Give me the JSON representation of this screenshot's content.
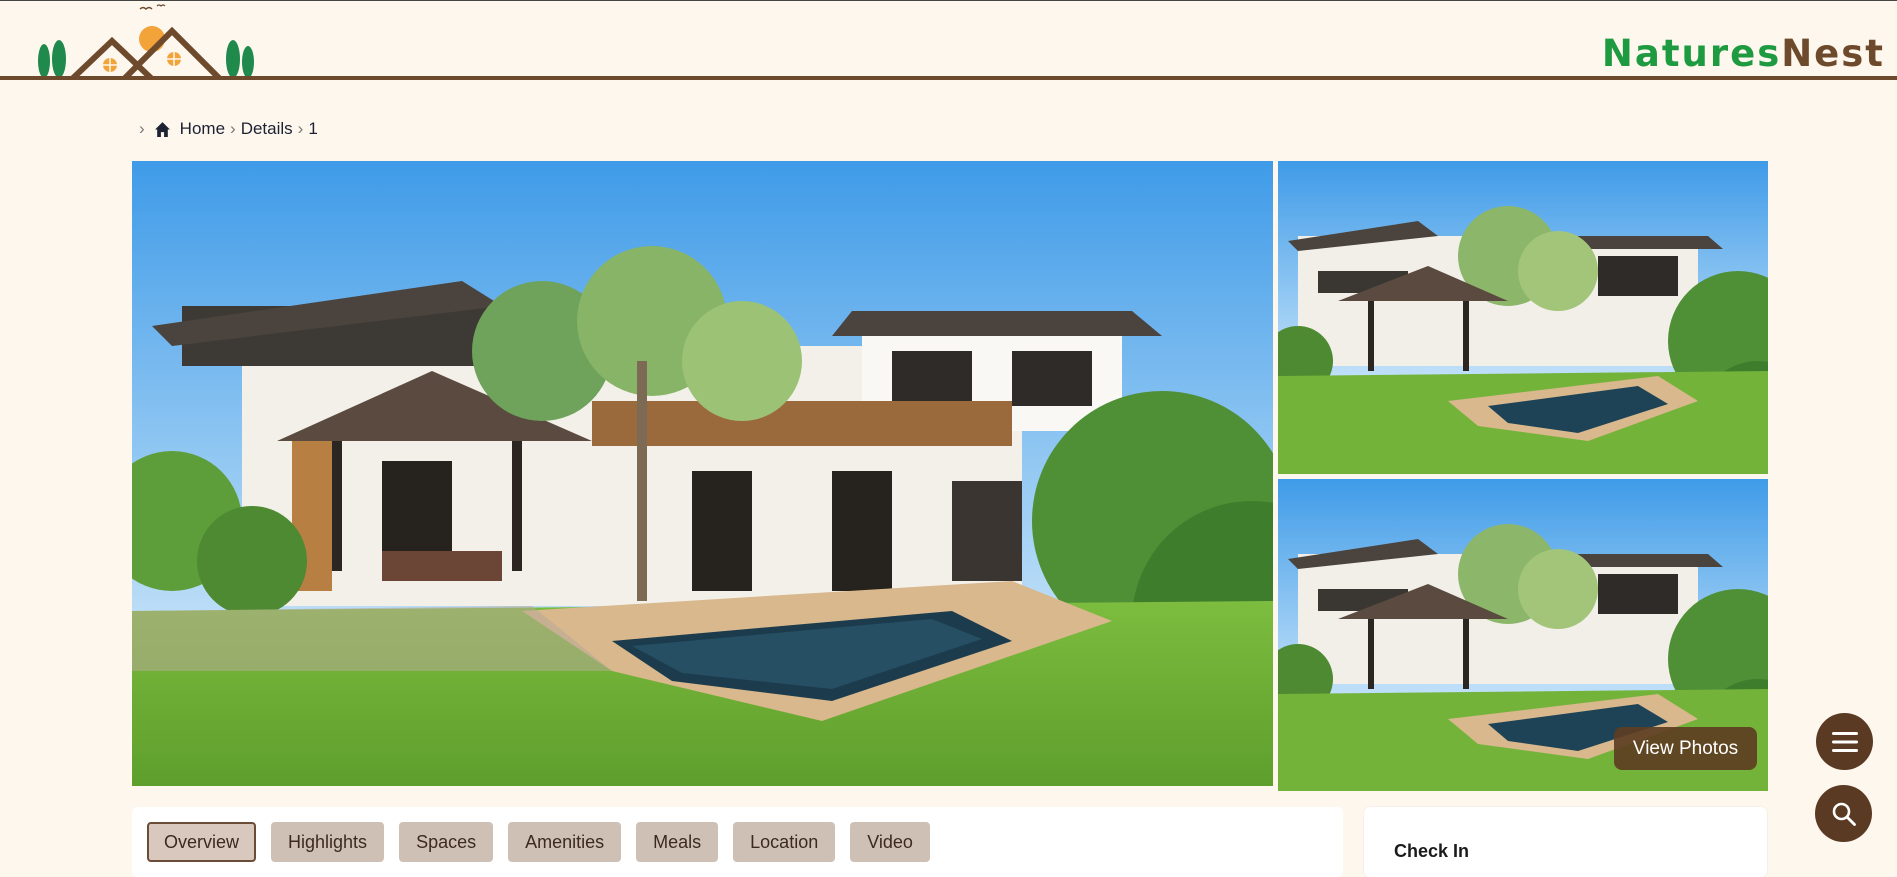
{
  "header": {
    "brand_part1": "Natures",
    "brand_part2": "Nest",
    "logo_icon": "house-logo",
    "colors": {
      "brand_green": "#1e9a41",
      "brand_brown": "#6d4a2b",
      "rule": "#6e4a2d"
    }
  },
  "breadcrumb": {
    "items": [
      "Home",
      "Details",
      "1"
    ],
    "home_icon": "home-icon"
  },
  "gallery": {
    "main_photo": "villa-photo",
    "thumbnails": [
      "villa-photo",
      "villa-photo"
    ],
    "view_photos_label": "View Photos"
  },
  "fabs": {
    "menu_icon": "hamburger-menu-icon",
    "search_icon": "search-icon"
  },
  "tabs": {
    "items": [
      "Overview",
      "Highlights",
      "Spaces",
      "Amenities",
      "Meals",
      "Location",
      "Video"
    ],
    "active": "Overview"
  },
  "booking": {
    "checkin_label": "Check In"
  },
  "colors": {
    "page_bg": "#fef7ee",
    "accent_dark": "#5a3a23",
    "tab_bg": "#cfc0b6"
  }
}
